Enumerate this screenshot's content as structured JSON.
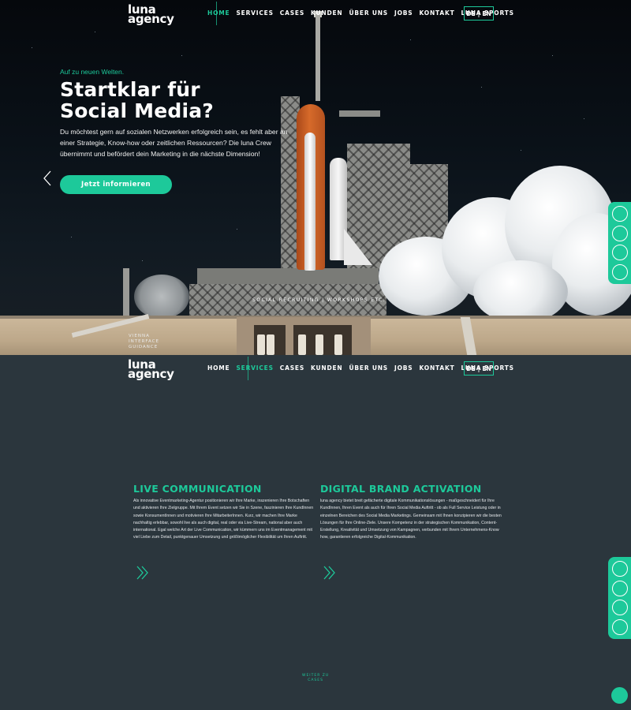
{
  "brand": {
    "logo_line1": "luna",
    "logo_line2": "agency",
    "accent": "#1dc99a",
    "dark_bg": "#2b363d"
  },
  "nav": {
    "items": [
      {
        "label": "HOME"
      },
      {
        "label": "SERVICES"
      },
      {
        "label": "CASES"
      },
      {
        "label": "KUNDEN"
      },
      {
        "label": "ÜBER UNS"
      },
      {
        "label": "JOBS"
      },
      {
        "label": "KONTAKT"
      },
      {
        "label": "LUNA SPORTS"
      }
    ],
    "lang_de": "DE",
    "lang_sep": "|",
    "lang_en": "EN"
  },
  "hero": {
    "kicker": "Auf zu neuen Welten.",
    "headline_line1": "Startklar für",
    "headline_line2": "Social Media?",
    "lead": "Du möchtest gern auf sozialen Netzwerken erfolgreich sein, es fehlt aber an einer Strategie, Know-how oder zeitlichen Ressourcen? Die luna Crew übernimmt und befördert dein Marketing in die nächste Dimension!",
    "cta": "Jetzt informieren",
    "caption": "SOCIAL RECRUITING | WORKSHOPS ETC.",
    "caption_small_1": "VIENNA",
    "caption_small_2": "INTERFACE",
    "caption_small_3": "GUIDANCE",
    "prev_icon": "chevron-left-icon"
  },
  "services": {
    "left": {
      "title": "LIVE COMMUNICATION",
      "body": "Als innovative Eventmarketing-Agentur positionieren wir Ihre Marke, inszenieren Ihre Botschaften und aktivieren Ihre Zielgruppe. Mit Ihrem Event setzen wir Sie in Szene, faszinieren Ihre KundInnen sowie KonsumentInnen und motivieren Ihre MitarbeiterInnen. Kurz, wir machen Ihre Marke nachhaltig erlebbar, sowohl live als auch digital, real oder via Live-Stream, national aber auch international. Egal welche Art der Live Communication, wir kümmern uns im Eventmanagement mit viel Liebe zum Detail, punktgenauer Umsetzung und größtmöglicher Flexibilität um Ihren Auftritt."
    },
    "right": {
      "title": "DIGITAL BRAND ACTIVATION",
      "body": "luna agency bietet breit gefächerte digitale Kommunikationslösungen - maßgeschneidert für Ihre KundInnen, Ihren Event als auch für Ihren Social Media Auftritt - ob als Full Service Leistung oder in einzelnen Bereichen des Social Media Marketings. Gemeinsam mit Ihnen konzipieren wir die besten Lösungen für Ihre Online-Ziele. Unsere Kompetenz in der strategischen Kommunikation, Content-Erstellung, Kreativität und Umsetzung von Kampagnen, verbunden mit Ihrem Unternehmens-Know how, garantieren erfolgreiche Digital-Kommunikation."
    },
    "scroll_hint_1": "WEITER ZU",
    "scroll_hint_2": "CASES"
  }
}
